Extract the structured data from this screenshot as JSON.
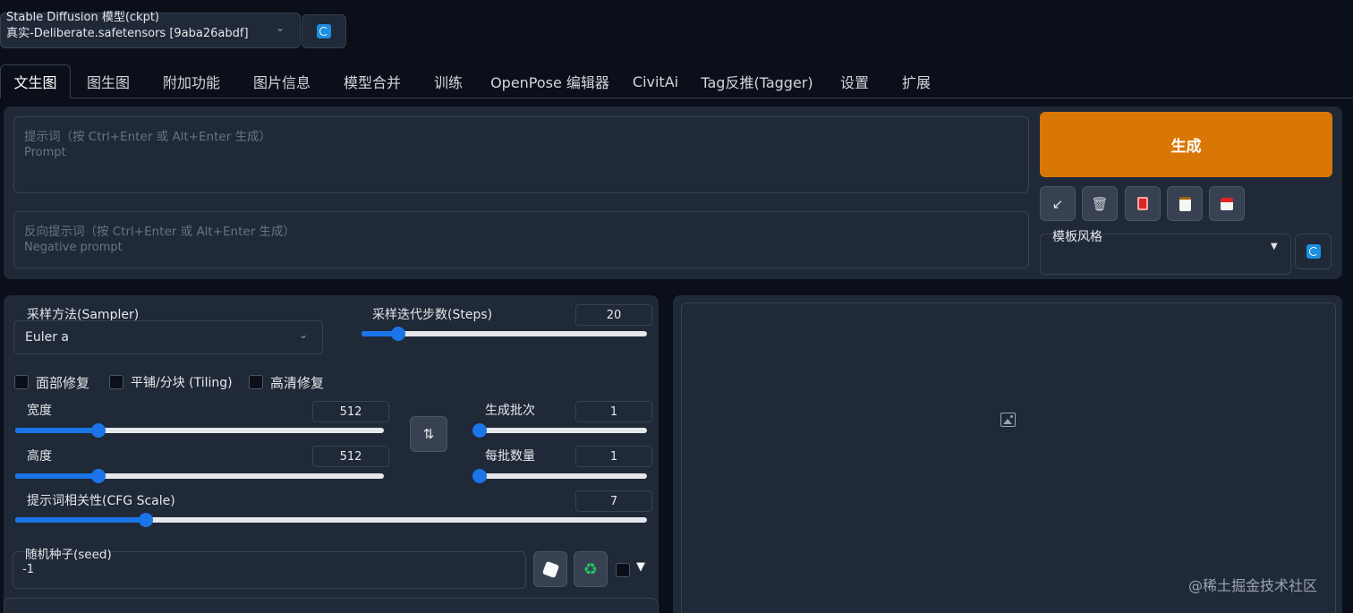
{
  "model": {
    "label": "Stable Diffusion 模型(ckpt)",
    "value": "真实-Deliberate.safetensors [9aba26abdf]"
  },
  "tabs": [
    {
      "label": "文生图"
    },
    {
      "label": "图生图"
    },
    {
      "label": "附加功能"
    },
    {
      "label": "图片信息"
    },
    {
      "label": "模型合并"
    },
    {
      "label": "训练"
    },
    {
      "label": "OpenPose 编辑器"
    },
    {
      "label": "CivitAi"
    },
    {
      "label": "Tag反推(Tagger)"
    },
    {
      "label": "设置"
    },
    {
      "label": "扩展"
    }
  ],
  "prompt": {
    "placeholder_cn": "提示词（按 Ctrl+Enter 或 Alt+Enter 生成）",
    "placeholder_en": "Prompt"
  },
  "negative_prompt": {
    "placeholder_cn": "反向提示词（按 Ctrl+Enter 或 Alt+Enter 生成）",
    "placeholder_en": "Negative prompt"
  },
  "generate_label": "生成",
  "tool_icons": [
    "arrow-icon",
    "trash-icon",
    "red-card-icon",
    "clipboard-icon",
    "save-icon"
  ],
  "style": {
    "label": "模板风格"
  },
  "sampler": {
    "label": "采样方法(Sampler)",
    "value": "Euler a"
  },
  "steps": {
    "label": "采样迭代步数(Steps)",
    "value": "20",
    "min": 1,
    "max": 150,
    "current": 20
  },
  "checkboxes": [
    {
      "label": "面部修复",
      "checked": false
    },
    {
      "label": "平铺/分块 (Tiling)",
      "checked": false
    },
    {
      "label": "高清修复",
      "checked": false
    }
  ],
  "width": {
    "label": "宽度",
    "value": "512",
    "min": 64,
    "max": 2048,
    "current": 512
  },
  "height": {
    "label": "高度",
    "value": "512",
    "min": 64,
    "max": 2048,
    "current": 512
  },
  "batch_count": {
    "label": "生成批次",
    "value": "1",
    "min": 1,
    "max": 100,
    "current": 1
  },
  "batch_size": {
    "label": "每批数量",
    "value": "1",
    "min": 1,
    "max": 8,
    "current": 1
  },
  "cfg": {
    "label": "提示词相关性(CFG Scale)",
    "value": "7",
    "min": 1,
    "max": 30,
    "current": 7
  },
  "seed": {
    "label": "随机种子(seed)",
    "value": "-1"
  },
  "seed_extra_toggle": "▼",
  "watermark": "@稀土掘金技术社区",
  "colors": {
    "background": "#0b0f19",
    "panel": "#1f2937",
    "border": "#374151",
    "generate": "#d97706",
    "accent": "#1b74e8"
  }
}
